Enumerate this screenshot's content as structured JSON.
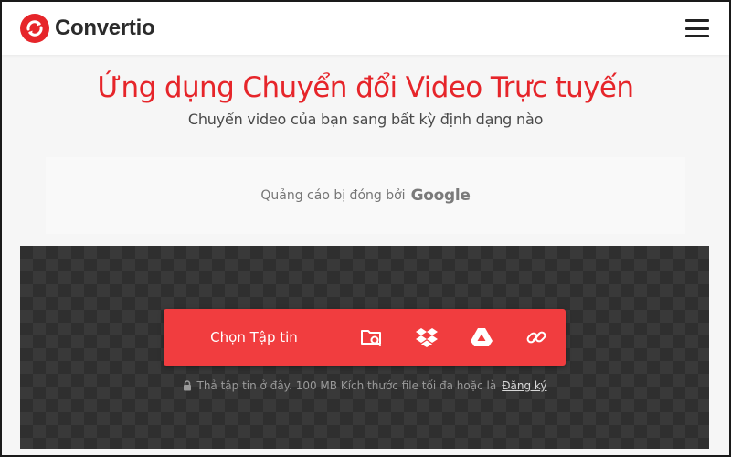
{
  "brand": {
    "name": "Convertio",
    "logo_icon": "convertio-logo-icon",
    "accent": "#e6252a"
  },
  "header": {
    "menu_icon": "hamburger-menu-icon"
  },
  "hero": {
    "title": "Ứng dụng Chuyển đổi Video Trực tuyến",
    "subtitle": "Chuyển video của bạn sang bất kỳ định dạng nào"
  },
  "ad": {
    "text": "Quảng cáo bị đóng bởi",
    "brand": "Google"
  },
  "upload": {
    "choose_label": "Chọn Tập tin",
    "sources": [
      {
        "name": "computer",
        "icon": "folder-search-icon"
      },
      {
        "name": "dropbox",
        "icon": "dropbox-icon"
      },
      {
        "name": "google-drive",
        "icon": "google-drive-icon"
      },
      {
        "name": "url",
        "icon": "link-icon"
      }
    ],
    "note": "Thả tập tin ở đây. 100 MB Kích thước file tối đa hoặc là",
    "signup": "Đăng ký",
    "bar_color": "#f13d3f"
  }
}
